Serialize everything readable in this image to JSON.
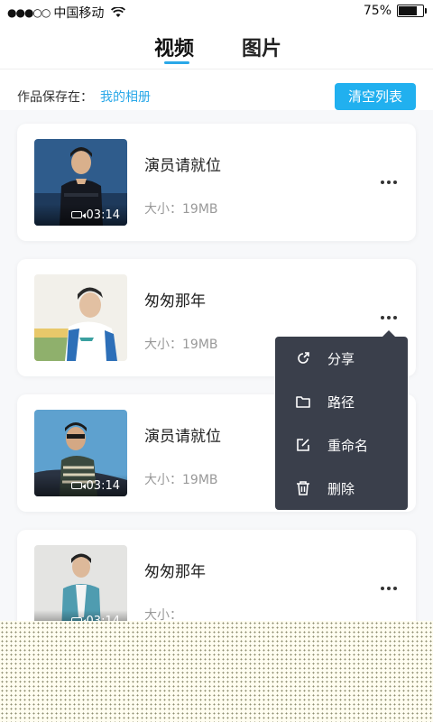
{
  "status_bar": {
    "signal_dots": "●●●○○",
    "carrier": "中国移动",
    "battery_text": "75%",
    "battery_level": 0.75
  },
  "tabs": [
    {
      "label": "视频",
      "active": true
    },
    {
      "label": "图片",
      "active": false
    }
  ],
  "save_location": {
    "label": "作品保存在：",
    "link": "我的相册"
  },
  "clear_button": "清空列表",
  "videos": [
    {
      "title": "演员请就位",
      "size": "大小：19MB",
      "duration": "03:14"
    },
    {
      "title": "匆匆那年",
      "size": "大小：19MB",
      "duration": ""
    },
    {
      "title": "演员请就位",
      "size": "大小：19MB",
      "duration": "03:14"
    },
    {
      "title": "匆匆那年",
      "size": "大小：",
      "duration": "03:14"
    }
  ],
  "context_menu": [
    {
      "label": "分享",
      "icon": "share-icon"
    },
    {
      "label": "路径",
      "icon": "folder-icon"
    },
    {
      "label": "重命名",
      "icon": "rename-icon"
    },
    {
      "label": "删除",
      "icon": "trash-icon"
    }
  ],
  "colors": {
    "accent": "#21b0ef",
    "menu_bg": "#3a3f4b"
  }
}
